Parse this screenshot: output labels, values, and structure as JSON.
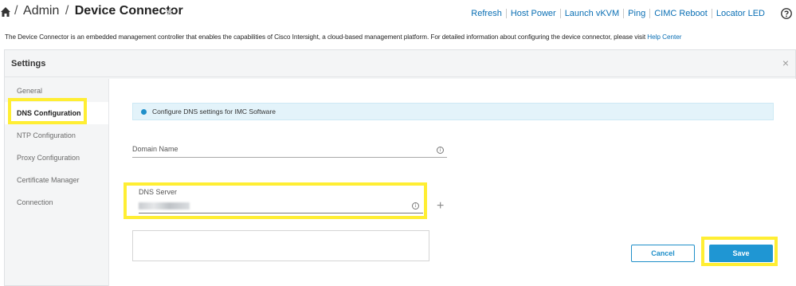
{
  "header": {
    "breadcrumb": [
      "Admin",
      "Device Connector"
    ],
    "separator": "/",
    "actions": [
      "Refresh",
      "Host Power",
      "Launch vKVM",
      "Ping",
      "CIMC Reboot",
      "Locator LED"
    ],
    "icons": [
      "home-icon",
      "star-icon",
      "help-icon"
    ]
  },
  "description": {
    "text": "The Device Connector is an embedded management controller that enables the capabilities of Cisco Intersight, a cloud-based management platform. For detailed information about configuring the device connector, please visit ",
    "link": "Help Center"
  },
  "modal": {
    "title": "Settings",
    "close_icon": "×",
    "nav": [
      "General",
      "DNS Configuration",
      "NTP Configuration",
      "Proxy Configuration",
      "Certificate Manager",
      "Connection"
    ],
    "active_nav": "DNS Configuration",
    "info_message": "Configure DNS settings for IMC Software",
    "domain_name_label": "Domain Name",
    "domain_name_value": "",
    "dns_server_label": "DNS Server",
    "plus": "+",
    "cancel_label": "Cancel",
    "save_label": "Save"
  },
  "colors": {
    "accent": "#1f96d3",
    "link": "#0a6fb4",
    "highlight": "#ffee33",
    "info_bg": "#e3f3fa"
  }
}
